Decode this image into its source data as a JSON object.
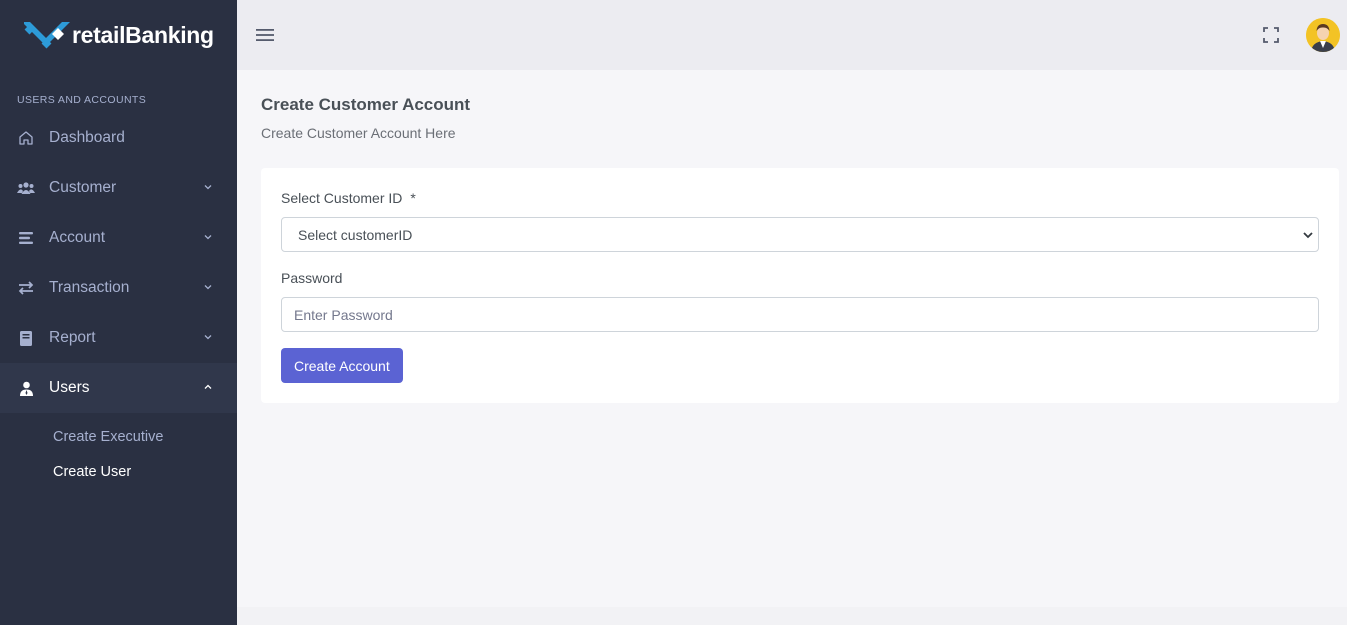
{
  "brand": {
    "name": "retailBanking"
  },
  "sidebar": {
    "section_title": "USERS AND ACCOUNTS",
    "items": [
      {
        "label": "Dashboard",
        "icon": "home-icon",
        "has_chevron": false
      },
      {
        "label": "Customer",
        "icon": "users-group-icon",
        "has_chevron": true
      },
      {
        "label": "Account",
        "icon": "layers-icon",
        "has_chevron": true
      },
      {
        "label": "Transaction",
        "icon": "transfer-arrows-icon",
        "has_chevron": true
      },
      {
        "label": "Report",
        "icon": "book-icon",
        "has_chevron": true
      },
      {
        "label": "Users",
        "icon": "user-tie-icon",
        "has_chevron": true,
        "expanded": true
      }
    ],
    "users_submenu": [
      "Create Executive",
      "Create User"
    ]
  },
  "topbar": {
    "menu_icon": "hamburger-icon",
    "fullscreen_icon": "fullscreen-icon",
    "avatar_icon": "user-avatar-icon"
  },
  "page": {
    "title": "Create Customer Account",
    "subtitle": "Create Customer Account Here"
  },
  "form": {
    "customer_id_label": "Select Customer ID",
    "required_mark": "*",
    "customer_id_selected": "Select customerID",
    "password_label": "Password",
    "password_placeholder": "Enter Password",
    "submit_label": "Create Account"
  },
  "colors": {
    "sidebar_bg": "#2a3042",
    "primary_button": "#5b63d3",
    "logo_accent": "#2d9bd8"
  }
}
